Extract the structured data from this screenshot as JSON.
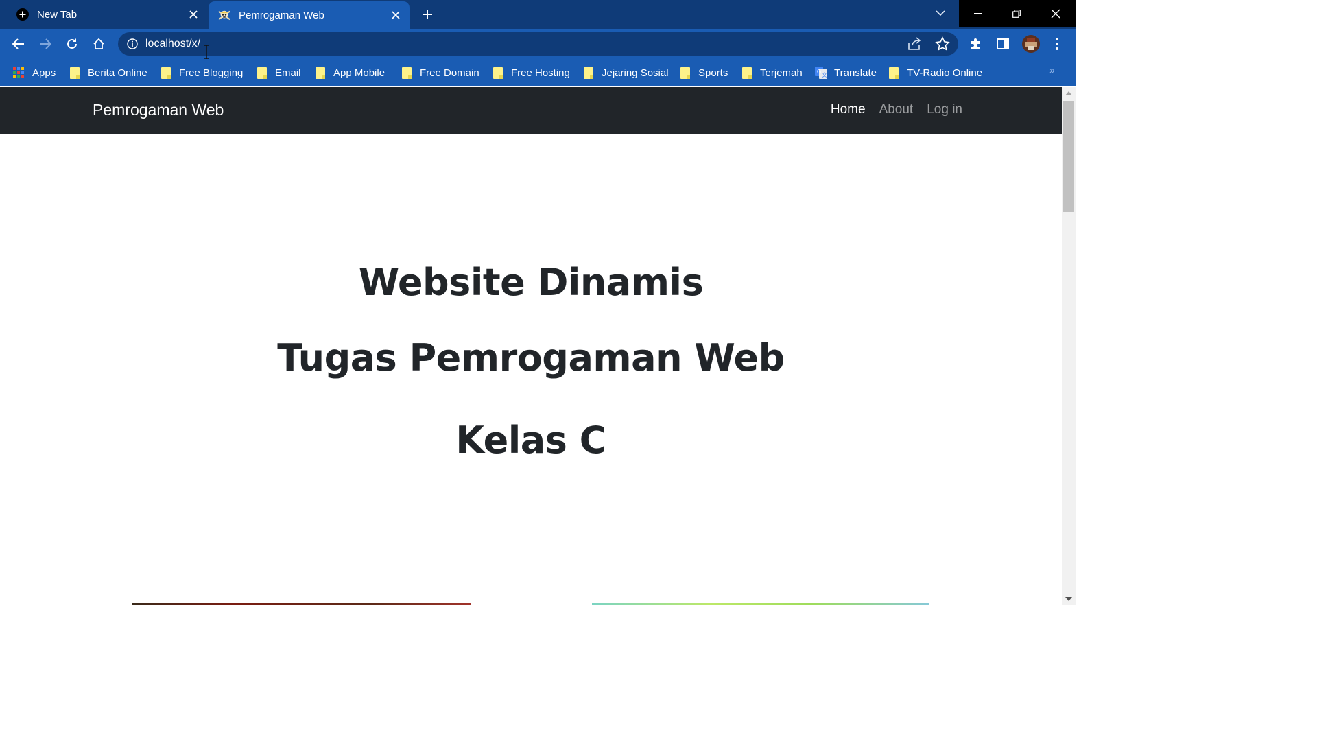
{
  "browser": {
    "tabs": [
      {
        "title": "New Tab",
        "icon": "new-tab-plus-icon",
        "active": false
      },
      {
        "title": "Pemrogaman Web",
        "icon": "pirate-skull-favicon",
        "active": true
      }
    ],
    "address": "localhost/x/",
    "bookmarks": [
      {
        "label": "Apps",
        "icon": "apps-grid-icon"
      },
      {
        "label": "Berita Online",
        "icon": "folder-icon"
      },
      {
        "label": "Free Blogging",
        "icon": "folder-icon"
      },
      {
        "label": "Email",
        "icon": "folder-icon"
      },
      {
        "label": "App Mobile",
        "icon": "folder-icon"
      },
      {
        "label": "Free Domain",
        "icon": "folder-icon"
      },
      {
        "label": "Free Hosting",
        "icon": "folder-icon"
      },
      {
        "label": "Jejaring Sosial",
        "icon": "folder-icon"
      },
      {
        "label": "Sports",
        "icon": "folder-icon"
      },
      {
        "label": "Terjemah",
        "icon": "folder-icon"
      },
      {
        "label": "Translate",
        "icon": "google-translate-icon"
      },
      {
        "label": "TV-Radio Online",
        "icon": "folder-icon"
      }
    ],
    "bookmarks_more": "»"
  },
  "site": {
    "brand": "Pemrogaman Web",
    "nav": [
      {
        "label": "Home",
        "active": true
      },
      {
        "label": "About",
        "active": false
      },
      {
        "label": "Log in",
        "active": false
      }
    ],
    "hero": {
      "line1": "Website Dinamis",
      "line2": "Tugas Pemrogaman Web",
      "line3": "Kelas C"
    }
  },
  "colors": {
    "tabstrip": "#0f3b78",
    "toolbar": "#1a5cb3",
    "navbar": "#212529",
    "folder": "#fdf28a"
  }
}
